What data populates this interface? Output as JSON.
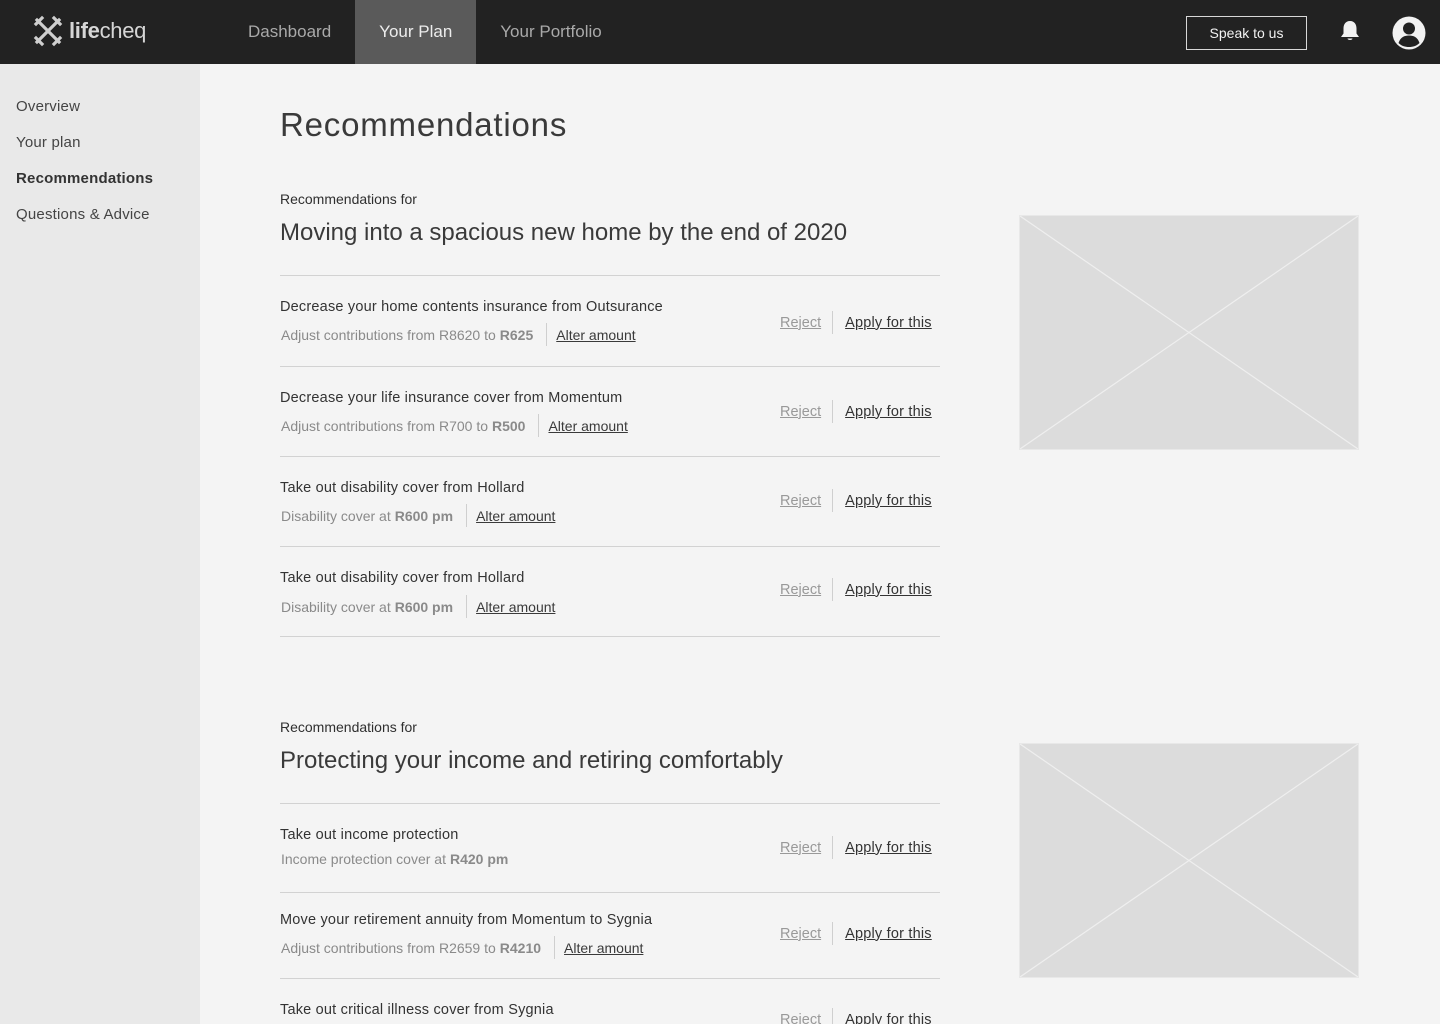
{
  "brand": {
    "logo_text_bold": "life",
    "logo_text_light": "cheq"
  },
  "nav": {
    "tabs": [
      {
        "label": "Dashboard"
      },
      {
        "label": "Your Plan"
      },
      {
        "label": "Your Portfolio"
      }
    ],
    "active_tab": "Your Plan",
    "speak_label": "Speak to us"
  },
  "icons": {
    "logo": "lifecheq-logo-icon",
    "bell": "bell-icon",
    "avatar": "user-avatar-icon"
  },
  "sidebar": {
    "items": [
      {
        "label": "Overview"
      },
      {
        "label": "Your plan"
      },
      {
        "label": "Recommendations"
      },
      {
        "label": "Questions & Advice"
      }
    ],
    "active_item": "Recommendations"
  },
  "page": {
    "title": "Recommendations"
  },
  "sections": [
    {
      "pre": "Recommendations for",
      "title": "Moving into a spacious new home by the end of 2020",
      "recs": [
        {
          "title": "Decrease your home contents insurance from Outsurance",
          "sub_text": "Adjust contributions from R8620 to",
          "amount": "R625",
          "alter": "Alter amount",
          "reject": "Reject",
          "apply": "Apply for this"
        },
        {
          "title": "Decrease your life insurance cover from Momentum",
          "sub_text": "Adjust contributions from R700 to",
          "amount": "R500",
          "alter": "Alter amount",
          "reject": "Reject",
          "apply": "Apply for this"
        },
        {
          "title": "Take out disability cover from Hollard",
          "sub_text": "Disability cover at",
          "amount": "R600 pm",
          "alter": "Alter amount",
          "reject": "Reject",
          "apply": "Apply for this"
        },
        {
          "title": "Take out disability cover from Hollard",
          "sub_text": "Disability cover at",
          "amount": "R600 pm",
          "alter": "Alter amount",
          "reject": "Reject",
          "apply": "Apply for this"
        }
      ]
    },
    {
      "pre": "Recommendations for",
      "title": "Protecting your income and retiring comfortably",
      "recs": [
        {
          "title": "Take out income protection",
          "sub_text": "Income protection cover at",
          "amount": "R420 pm",
          "reject": "Reject",
          "apply": "Apply for this"
        },
        {
          "title": "Move your retirement annuity from Momentum to Sygnia",
          "sub_text": "Adjust contributions from R2659 to",
          "amount": "R4210",
          "alter": "Alter amount",
          "reject": "Reject",
          "apply": "Apply for this"
        },
        {
          "title": "Take out critical illness cover from Sygnia",
          "reject": "Reject",
          "apply": "Apply for this"
        }
      ]
    }
  ],
  "colors": {
    "topbar": "#222222",
    "active_tab": "#5a5a5a",
    "sidebar": "#e9e9e9",
    "content_bg": "#f4f4f4",
    "placeholder": "#dcdcdc"
  }
}
